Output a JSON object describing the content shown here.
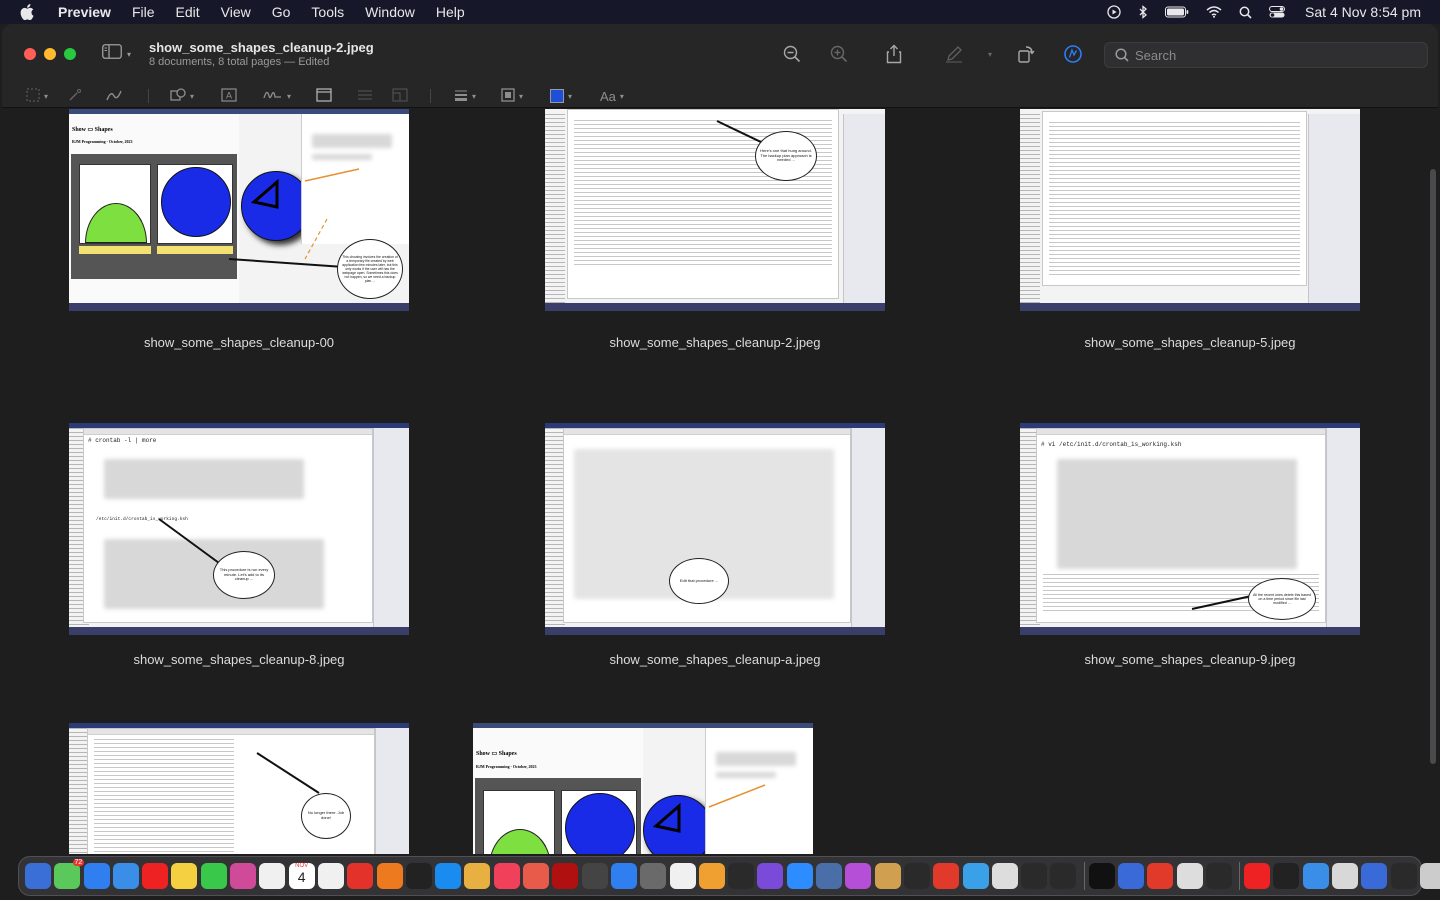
{
  "menubar": {
    "app_name": "Preview",
    "items": [
      "File",
      "Edit",
      "View",
      "Go",
      "Tools",
      "Window",
      "Help"
    ],
    "clock": "Sat 4 Nov  8:54 pm",
    "status_icons": [
      "play-circle-icon",
      "bluetooth-icon",
      "battery-icon",
      "wifi-icon",
      "spotlight-icon",
      "control-center-icon"
    ]
  },
  "window": {
    "title": "show_some_shapes_cleanup-2.jpeg",
    "subtitle": "8 documents, 8 total pages — Edited",
    "search_placeholder": "Search"
  },
  "markup": {
    "text_style_label": "Aa",
    "accent_color": "#1f4fd8"
  },
  "thumbnails": [
    {
      "label": "show_some_shapes_cleanup-00",
      "bubble": "This chowing involves the creation of a temporary file created by web application few minutes later, but this only works if the user will has the webpage open. Sometimes this does not happen, so we need a backup plan ..."
    },
    {
      "label": "show_some_shapes_cleanup-2.jpeg",
      "bubble": "Here's one that hung around. The backup plan approach is needed ..."
    },
    {
      "label": "show_some_shapes_cleanup-5.jpeg",
      "bubble": ""
    },
    {
      "label": "show_some_shapes_cleanup-8.jpeg",
      "bubble": "This procedure is run every minute. Let's add to its cleanup ...",
      "cmd": "# crontab -l | more",
      "cmd2": "/etc/init.d/crontab_is_working.ksh"
    },
    {
      "label": "show_some_shapes_cleanup-a.jpeg",
      "bubble": "Edit that procedure ..."
    },
    {
      "label": "show_some_shapes_cleanup-9.jpeg",
      "bubble": "All the recent ones delete this based on a time period since file last modified ...",
      "cmd": "# vi /etc/init.d/crontab_is_working.ksh"
    },
    {
      "label": "",
      "bubble": "No longer there. Job done!"
    },
    {
      "label": "",
      "bubble": ""
    }
  ],
  "dock": {
    "badge_count": "72",
    "calendar_month": "NOV",
    "calendar_day": "4",
    "colors": [
      "#3b6fd8",
      "#5ac85a",
      "#2f7ff0",
      "#3a8ee8",
      "#e22",
      "#f5d040",
      "#3ac84a",
      "#d04a9a",
      "#f0f0f0",
      "#4ab0e0",
      "#f0f0f0",
      "#e2322a",
      "#ee7a20",
      "#222",
      "#1a8cf0",
      "#e8b040",
      "#f0405a",
      "#e85a4a",
      "#b01010",
      "#444",
      "#2f7ff0",
      "#6a6a6a",
      "#f0f0f0",
      "#f0a030",
      "#2a2a2a",
      "#7a4ad8",
      "#2d8cff",
      "#4a6fa8",
      "#b54fd8",
      "#d0a050",
      "#2a2a2a",
      "#e23a2a",
      "#3aa0e8",
      "#ddd",
      "#2a2a2a",
      "#2a2a2a",
      "#111",
      "#3a6ad8",
      "#e23a2a",
      "#ddd",
      "#2a2a2a",
      "#e22",
      "#222",
      "#3a8ee8",
      "#d8d8d8",
      "#3a6ad8",
      "#2a2a2a",
      "#ccc",
      "#888"
    ]
  }
}
